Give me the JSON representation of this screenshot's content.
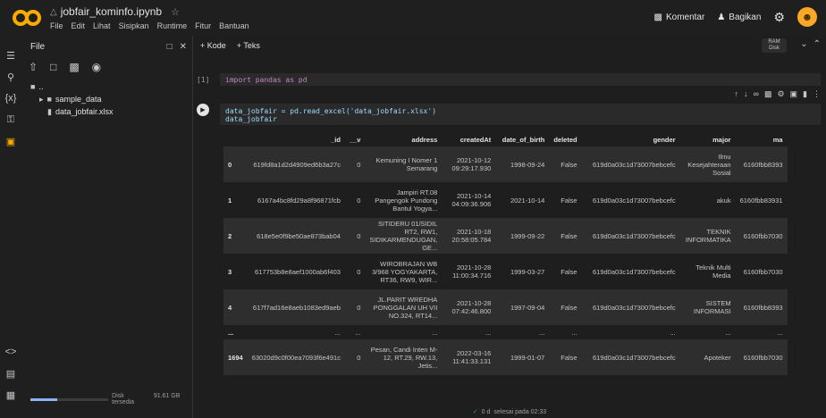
{
  "header": {
    "title": "jobfair_kominfo.ipynb",
    "menu": [
      "File",
      "Edit",
      "Lihat",
      "Sisipkan",
      "Runtime",
      "Fitur",
      "Bantuan"
    ],
    "comment_label": "Komentar",
    "share_label": "Bagikan"
  },
  "files_panel": {
    "title": "File",
    "tree": [
      {
        "name": "..",
        "type": "folder",
        "indent": false
      },
      {
        "name": "sample_data",
        "type": "folder",
        "indent": true
      },
      {
        "name": "data_jobfair.xlsx",
        "type": "file",
        "indent": true
      }
    ],
    "disk_text": "Disk                 91.61 GB tersedia",
    "disk_fill": 0.35
  },
  "toolbar": {
    "code_label": "+ Kode",
    "text_label": "+ Teks",
    "ram_label": "RAM",
    "disk_label": "Disk"
  },
  "cells": [
    {
      "exec": "[1]",
      "code": "import pandas as pd"
    },
    {
      "exec": "",
      "code_line1": "data_jobfair = pd.read_excel('data_jobfair.xlsx')",
      "code_line2": "data_jobfair"
    }
  ],
  "dataframe": {
    "columns": [
      "",
      "_id",
      "__v",
      "address",
      "createdAt",
      "date_of_birth",
      "deleted",
      "gender",
      "major",
      "ma"
    ],
    "rows": [
      [
        "0",
        "619fd8a1d2d4909ed6b3a27c",
        "0",
        "Kemuning I Nomer 1 Semarang",
        "2021-10-12 09:29:17.930",
        "1998-09-24",
        "False",
        "619d0a03c1d73007bebcefc",
        "Ilmu Kesejahteraan Sosial",
        "6160fbb8393"
      ],
      [
        "1",
        "6167a4bc8fd29a8f96871fcb",
        "0",
        "Jampiri RT.08 Pangengok Pundong Bantul Yogya...",
        "2021-10-14 04:09:36.906",
        "2021-10-14",
        "False",
        "619d0a03c1d73007bebcefc",
        "akuk",
        "6160fbb83931"
      ],
      [
        "2",
        "618e5e0f9be50ae873bab04",
        "0",
        "SITIDERU 01/SIDIL RT2, RW1, SIDIKARMENDUGAN, GE...",
        "2021-10-18 20:58:05.784",
        "1999-09-22",
        "False",
        "619d0a03c1d73007bebcefc",
        "TEKNIK INFORMATIKA",
        "6160fbb7030"
      ],
      [
        "3",
        "617753b8e8aef1000ab6f403",
        "0",
        "WIROBRAJAN WB 3/968 YOGYAKARTA, RT36, RW9, WIR...",
        "2021-10-28 11:00:34.716",
        "1999-03-27",
        "False",
        "619d0a03c1d73007bebcefc",
        "Teknik Multi Media",
        "6160fbb7030"
      ],
      [
        "4",
        "617f7ad16e8aeb1083ed9aeb",
        "0",
        "JL.PARIT WREDHA PONGGALAN UH VII NO.324, RT14...",
        "2021-10-28 07:42:46.800",
        "1997-09-04",
        "False",
        "619d0a03c1d73007bebcefc",
        "SISTEM INFORMASI",
        "6160fbb8393"
      ]
    ],
    "ellipsis": "...",
    "last_row": [
      "1694",
      "63020d9c0f00ea7093f6e491c",
      "0",
      "Pesan, Candi Inten M-12, RT.29, RW.13, Jetis...",
      "2022-03-16 11:41:33.131",
      "1999-01-07",
      "False",
      "619d0a03c1d73007bebcefc",
      "Apoteker",
      "6160fbb7030"
    ]
  },
  "status": {
    "check": "✓",
    "time": "0 d",
    "text": "selesai pada 02:33"
  }
}
